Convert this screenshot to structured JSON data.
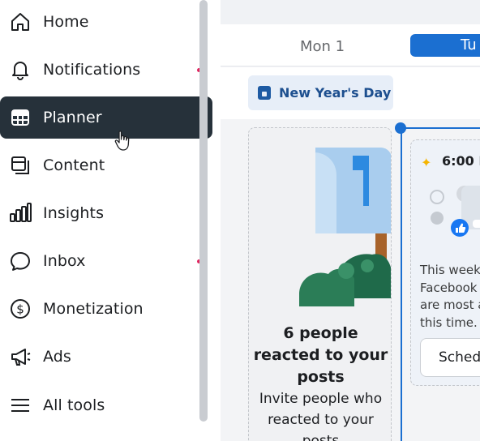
{
  "sidebar": {
    "items": [
      {
        "label": "Home",
        "icon": "home-icon"
      },
      {
        "label": "Notifications",
        "icon": "bell-icon"
      },
      {
        "label": "Planner",
        "icon": "calendar-grid-icon",
        "active": true
      },
      {
        "label": "Content",
        "icon": "content-icon"
      },
      {
        "label": "Insights",
        "icon": "bar-chart-icon"
      },
      {
        "label": "Inbox",
        "icon": "chat-bubble-icon"
      },
      {
        "label": "Monetization",
        "icon": "dollar-icon"
      },
      {
        "label": "Ads",
        "icon": "megaphone-icon"
      },
      {
        "label": "All tools",
        "icon": "menu-icon"
      }
    ]
  },
  "calendar": {
    "days": [
      "Mon 1",
      "Tu"
    ],
    "holiday": "New Year's Day",
    "engagement_card": {
      "title": "6 people reacted to your posts",
      "body": "Invite people who reacted to your posts"
    },
    "suggested_slot": {
      "time": "6:00 I",
      "tip_lines": [
        "This week",
        "Facebook",
        "are most a",
        "this time."
      ],
      "button": "Sched"
    }
  },
  "colors": {
    "active_nav_bg": "#26313a",
    "accent_blue": "#1b6fd1",
    "notification_dot": "#e0245e"
  }
}
